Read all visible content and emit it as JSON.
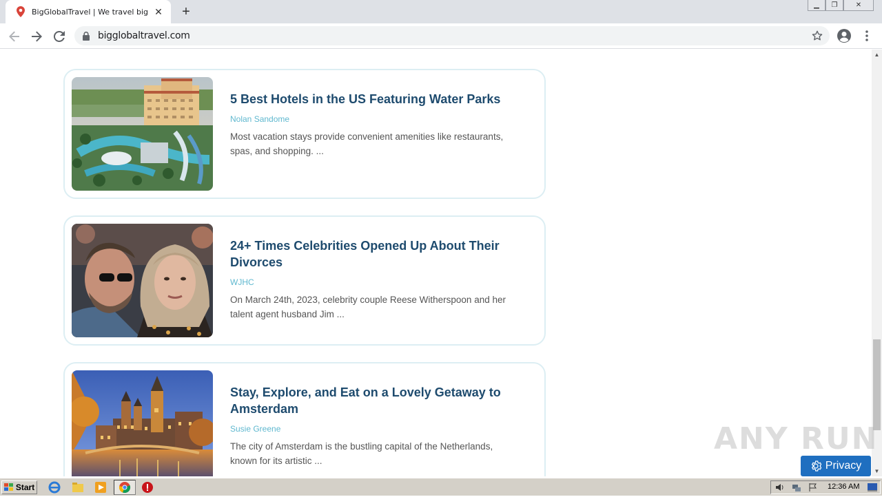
{
  "browser": {
    "tab_title": "BigGlobalTravel | We travel big and c",
    "url": "bigglobaltravel.com"
  },
  "articles": [
    {
      "title": "5 Best Hotels in the US Featuring Water Parks",
      "author": "Nolan Sandome",
      "excerpt": "Most vacation stays provide convenient amenities like restaurants, spas, and shopping. ..."
    },
    {
      "title": "24+ Times Celebrities Opened Up About Their Divorces",
      "author": "WJHC",
      "excerpt": "On March 24th, 2023, celebrity couple Reese Witherspoon and her talent agent husband Jim ..."
    },
    {
      "title": "Stay, Explore, and Eat on a Lovely Getaway to Amsterdam",
      "author": "Susie Greene",
      "excerpt": "The city of Amsterdam is the bustling capital of the Netherlands, known for its artistic ..."
    }
  ],
  "privacy_button": "Privacy",
  "watermark": "ANY RUN",
  "taskbar": {
    "start_label": "Start",
    "clock": "12:36 AM"
  },
  "colors": {
    "headline": "#1e4b6e",
    "author": "#5fb8cf",
    "card_border": "#dceef3",
    "privacy_bg": "#1f6fc0"
  }
}
